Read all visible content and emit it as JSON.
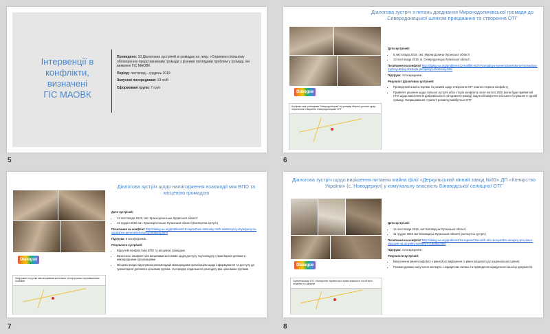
{
  "slides": [
    {
      "number": "5",
      "title_lines": [
        "Інтервенції в",
        "конфлікти,",
        "визначені",
        "ГІС МАОВК"
      ],
      "info": {
        "held_label": "Проведено:",
        "held_text": "10 Діалогових зустрічей в громадах на тему: «Сприяння спільному обговоренню представниками громади з різними поглядами проблем у громаді, які виявлені ГІС МАОВК",
        "period_label": "Період:",
        "period_text": "листопад – грудень 2019",
        "mediators_label": "Залучені посередники:",
        "mediators_text": "13 осіб",
        "groups_label": "Сформовані групи:",
        "groups_text": "7 груп"
      }
    },
    {
      "number": "6",
      "title": "Діалогова зустріч з питань доєднання Миронодолинівської громади до Северодонецької шляхом приєднання та створення ОТГ",
      "logo_text": "Dialogue",
      "card_title": "Конфлікт між громадами Северодонецька та громади Мирної долини щодо перспектив створення Северодонецької ОТГ",
      "meeting_dates_label": "Дати зустрічей:",
      "dates": [
        "5 листопада 2019, смт. Мирна Долина Луганської області",
        "13 листопада 2019, м. Северодонецьк Луганської області."
      ],
      "link_label": "Посилання на конфлікт",
      "link": "http://dialog-ua.org/problems/12-konflikt-mizh-hromadoyu-syeverodonetska-ta-hromadoyu-myrnoyi-doliny-shchodo-perspektyv-stvorenny.html",
      "support_label": "Підтрука:",
      "support_text": "4 посередники",
      "results_label": "Результат Діалогових зустрічей:",
      "results": [
        "Проведений аналіз переваг та ризиків щодо створення ОТГ кожної сторони конфлікту",
        "Прийняте рішення щодо спільної зустрічі обох сторін конфлікту після лютого 2020 (коли буде прийнятий НПА щодо виключення добровільності об'єднання громад) задля обговорення спільного існування в єдиній громаді. Напрацювання стратегії розвитку майбутньої ОТГ"
      ]
    },
    {
      "number": "7",
      "title": "Діалогова зустріч щодо налагодження взаємодії між ВПО та місцевою громадою",
      "logo_text": "Dialogue",
      "card_title": "Напружені стосунки між місцевими жителями та внутрішньо переміщеними особами",
      "meeting_dates_label": "Дати зустрічей:",
      "dates": [
        "13 листопада 2019, смт. Красноріченське Луганської області",
        "12 грудня 2019 смт. Красноріченське Луганської області (Експертна зустріч)"
      ],
      "link_label": "Посилання на конфлікт",
      "link": "http://dialog-ua.org/problems/19-napruzheni-stosunky-mizh-mistsevymy-zhytelyamy-ta-vnutrishno-peremishchenymy-osobamy.html",
      "support_label": "Підтрука:",
      "support_text": "5 посередників.",
      "results_label": "Результати зустрічей:",
      "results": [
        "Відсутній конфлікт між ВПО та місцевою громадою",
        "Визначено конфлікт між місцевими жителями щодо доступу та розподілу гуманітарної допомоги міжнародними організаціями",
        "Місцева влада підготувала рекомендації міжнародним організаціям щодо інформування та доступу до гуманітарної допомоги цільовим групам, та порядок подальшого розподілу між цільовими групами"
      ]
    },
    {
      "number": "8",
      "title": "Діалогова зустріч щодо вирішення питання майна філії «Деркульський кінний завод №63» ДП «Конярство України» (с. Новодеркул) у комунальну власність Біловодської селищної ОТГ",
      "logo_text": "Dialogue",
      "card_title": "Суперечка між ОТГ і Конярство України про право власності на об'єкти соціальн в с.Деркул",
      "meeting_dates_label": "Дати зустрічей:",
      "dates": [
        "14 листопада 2019, смт Біловодськ Луганської області.",
        "11 грудня 2019 смт Біловодськ Луганської області (експертна зустріч)"
      ],
      "link_label": "Посилання на конфлікт",
      "link": "http://dialog-ua.org/problems/14-superechka-mizh-oth-i-konyarstvo-ukrayiny-pro-pravo-vlasnosti-na-ob-yekty-sotsfery-v-s-derkul.html",
      "support_label": "Підтрука:",
      "support_text": "4 посередники",
      "results_label": "Результати зустрічей:",
      "results": [
        "Визначення рівня конфлікту з рівня його вирішення (з рівня місцевого до національного рівня)",
        "Рекомендовано залучення експерта з юридичних питань та проведення юридичного аналізу документів"
      ]
    }
  ]
}
